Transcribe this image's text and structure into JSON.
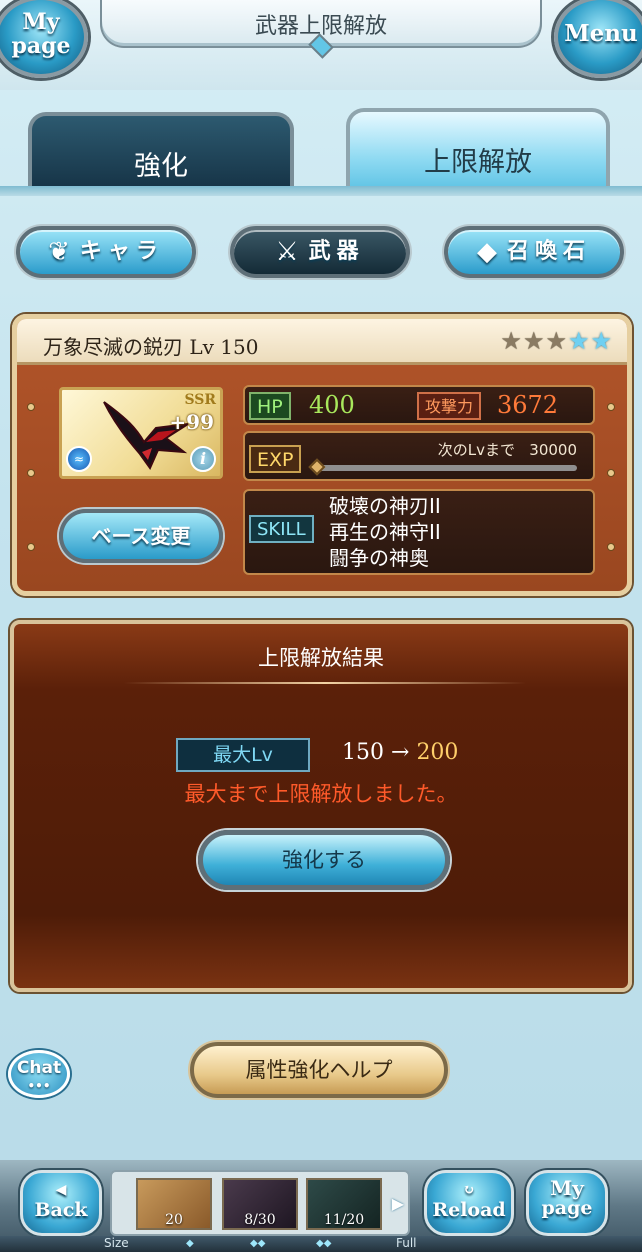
{
  "header": {
    "title": "武器上限解放",
    "mypage_line1": "My",
    "mypage_line2": "page",
    "menu_label": "Menu"
  },
  "tabs": [
    {
      "label": "強化",
      "active": false
    },
    {
      "label": "上限解放",
      "active": true
    }
  ],
  "categories": [
    {
      "label": "キャラ",
      "icon": "chara-emblem-icon",
      "selected": false
    },
    {
      "label": "武器",
      "icon": "crossed-swords-icon",
      "selected": true
    },
    {
      "label": "召喚石",
      "icon": "crystal-icon",
      "selected": false
    }
  ],
  "weapon": {
    "name": "万象尽滅の鋭刃",
    "level": "Lv 150",
    "stars": {
      "filled": 3,
      "blue": 2
    },
    "rarity": "SSR",
    "plus": "+99",
    "element_icon": "water-element-icon",
    "hp_label": "HP",
    "hp": "400",
    "atk_label": "攻撃力",
    "atk": "3672",
    "exp_label": "EXP",
    "exp_next_label": "次のLvまで",
    "exp_next_value": "30000",
    "exp_progress": 0,
    "skill_label": "SKILL",
    "skills": [
      "破壊の神刃II",
      "再生の神守II",
      "闘争の神奥"
    ],
    "base_change_label": "ベース変更"
  },
  "result": {
    "title": "上限解放結果",
    "maxlv_label": "最大Lv",
    "old_lv": "150",
    "arrow": "→",
    "new_lv": "200",
    "message": "最大まで上限解放しました。",
    "enhance_button": "強化する"
  },
  "help_button": "属性強化ヘルプ",
  "chat_button": "Chat",
  "bottom": {
    "back_top": "◀",
    "back_label": "Back",
    "reload_top": "↻",
    "reload_label": "Reload",
    "mypage_top": "My",
    "mypage_label": "page",
    "slots": [
      "20",
      "8/30",
      "11/20"
    ],
    "size_label": "Size",
    "full_label": "Full"
  },
  "colors": {
    "accent": "#2a9bc9",
    "panel": "#9a4720",
    "hp": "#a9e85c",
    "atk": "#ff7a3a",
    "message": "#ff5a2a"
  }
}
